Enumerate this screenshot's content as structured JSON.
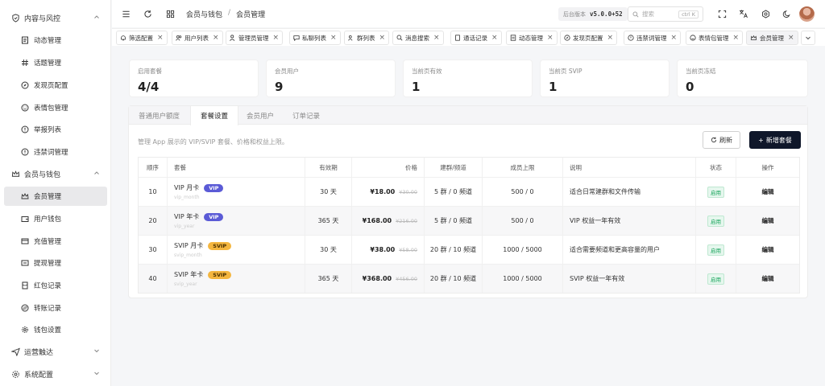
{
  "sidebar": {
    "groups": [
      {
        "label": "内容与风控",
        "items": [
          "动态管理",
          "话题管理",
          "发现页配置",
          "表情包管理",
          "举报列表",
          "违禁词管理"
        ]
      },
      {
        "label": "会员与钱包",
        "items": [
          "会员管理",
          "用户钱包",
          "充值管理",
          "提现管理",
          "红包记录",
          "转账记录",
          "钱包设置"
        ]
      },
      {
        "label": "运营触达",
        "items": []
      },
      {
        "label": "系统配置",
        "items": []
      }
    ]
  },
  "header": {
    "breadcrumb": [
      "会员与钱包",
      "会员管理"
    ],
    "version_label": "后台版本",
    "version": "v5.0.0+52",
    "search_placeholder": "搜索",
    "search_shortcut": "ctrl K"
  },
  "tabs": [
    "筛选配置",
    "用户列表",
    "管理员管理",
    "私聊列表",
    "群列表",
    "消息搜索",
    "通话记录",
    "动态管理",
    "发现页配置",
    "违禁词管理",
    "表情包管理",
    "会员管理"
  ],
  "stats": [
    {
      "label": "启用套餐",
      "value": "4/4"
    },
    {
      "label": "会员用户",
      "value": "9"
    },
    {
      "label": "当前页有效",
      "value": "1"
    },
    {
      "label": "当前页 SVIP",
      "value": "1"
    },
    {
      "label": "当前页冻结",
      "value": "0"
    }
  ],
  "panel": {
    "tabs": [
      "普通用户额度",
      "套餐设置",
      "会员用户",
      "订单记录"
    ],
    "description": "管理 App 展示的 VIP/SVIP 套餐、价格和权益上限。",
    "refresh_label": "刷新",
    "add_label": "新增套餐"
  },
  "table": {
    "columns": [
      "顺序",
      "套餐",
      "有效期",
      "价格",
      "建群/频道",
      "成员上限",
      "说明",
      "状态",
      "操作"
    ],
    "rows": [
      {
        "order": "10",
        "name": "VIP 月卡",
        "badge": "VIP",
        "code": "vip_month",
        "period": "30 天",
        "price": "¥18.00",
        "orig": "¥30.00",
        "create": "5 群 / 0 频道",
        "limit": "500 / 0",
        "desc": "适合日常建群和文件传输",
        "status": "启用",
        "action": "编辑"
      },
      {
        "order": "20",
        "name": "VIP 年卡",
        "badge": "VIP",
        "code": "vip_year",
        "period": "365 天",
        "price": "¥168.00",
        "orig": "¥216.00",
        "create": "5 群 / 0 频道",
        "limit": "500 / 0",
        "desc": "VIP 权益一年有效",
        "status": "启用",
        "action": "编辑"
      },
      {
        "order": "30",
        "name": "SVIP 月卡",
        "badge": "SVIP",
        "code": "svip_month",
        "period": "30 天",
        "price": "¥38.00",
        "orig": "¥58.00",
        "create": "20 群 / 10 频道",
        "limit": "1000 / 5000",
        "desc": "适合需要频道和更高容量的用户",
        "status": "启用",
        "action": "编辑"
      },
      {
        "order": "40",
        "name": "SVIP 年卡",
        "badge": "SVIP",
        "code": "svip_year",
        "period": "365 天",
        "price": "¥368.00",
        "orig": "¥456.00",
        "create": "20 群 / 10 频道",
        "limit": "1000 / 5000",
        "desc": "SVIP 权益一年有效",
        "status": "启用",
        "action": "编辑"
      }
    ]
  },
  "colors": {
    "primary_button": "#0f172a",
    "vip_badge": "#5b5bd6",
    "svip_badge": "#f4b63f",
    "status_green": "#15a35a"
  }
}
